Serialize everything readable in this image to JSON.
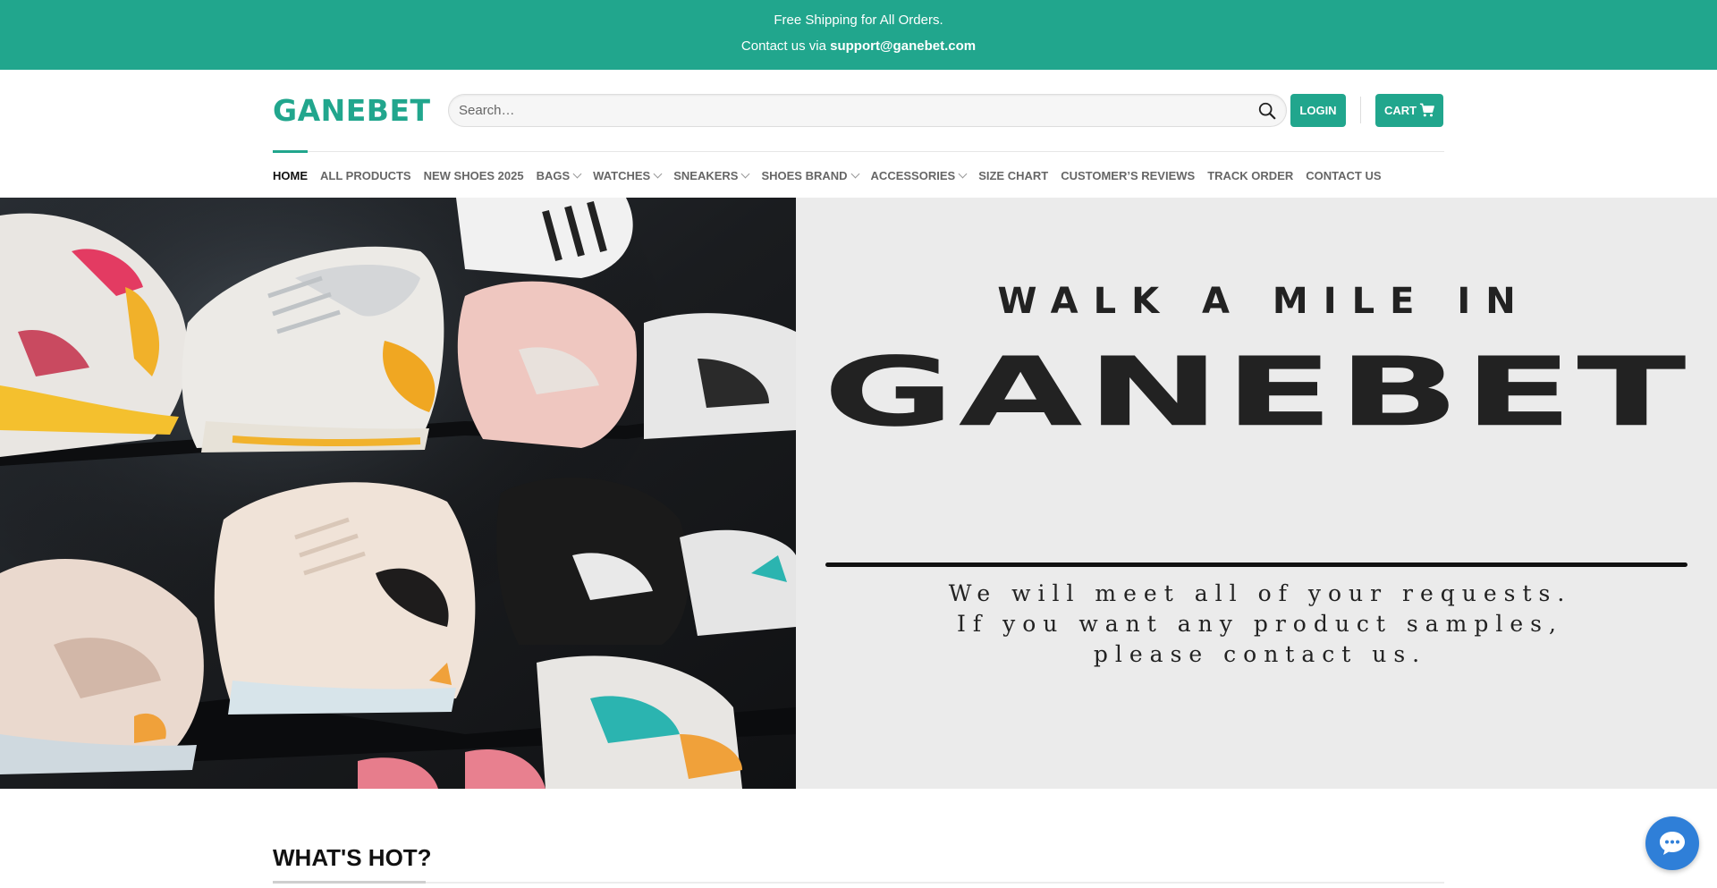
{
  "topbar": {
    "line1": "Free Shipping for All Orders.",
    "line2_prefix": "Contact us via ",
    "line2_email": "support@ganebet.com"
  },
  "header": {
    "logo": "GANEBET",
    "search_placeholder": "Search…",
    "login_label": "LOGIN",
    "cart_label": "CART"
  },
  "nav": {
    "items": [
      {
        "label": "HOME",
        "active": true,
        "dropdown": false
      },
      {
        "label": "ALL PRODUCTS",
        "dropdown": false
      },
      {
        "label": "NEW SHOES 2025",
        "dropdown": false
      },
      {
        "label": "BAGS",
        "dropdown": true
      },
      {
        "label": "WATCHES",
        "dropdown": true
      },
      {
        "label": "SNEAKERS",
        "dropdown": true
      },
      {
        "label": "SHOES BRAND",
        "dropdown": true
      },
      {
        "label": "ACCESSORIES",
        "dropdown": true
      },
      {
        "label": "SIZE CHART",
        "dropdown": false
      },
      {
        "label": "CUSTOMER’S REVIEWS",
        "dropdown": false
      },
      {
        "label": "TRACK ORDER",
        "dropdown": false
      },
      {
        "label": "CONTACT US",
        "dropdown": false
      }
    ]
  },
  "hero": {
    "eyebrow": "WALK A MILE IN",
    "brand": "GANEBET",
    "sub_line1": "We will meet all of your requests.",
    "sub_line2": "If you want any product samples,",
    "sub_line3": "please contact us."
  },
  "section": {
    "title": "WHAT'S HOT?"
  },
  "colors": {
    "brand": "#21a68d",
    "hero_bg": "#ebebeb",
    "chat": "#2f7fd8"
  },
  "icons": {
    "search": "search-icon",
    "cart": "cart-icon",
    "chat": "chat-bubble-icon"
  }
}
